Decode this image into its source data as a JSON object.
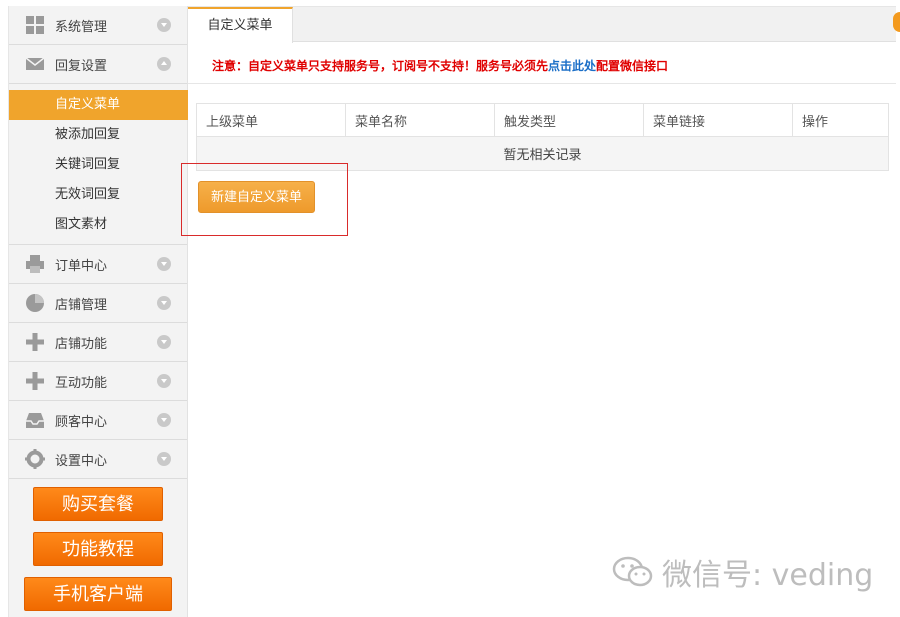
{
  "sidebar": {
    "menus": [
      {
        "label": "系统管理",
        "icon": "grid-icon",
        "expanded": false
      },
      {
        "label": "回复设置",
        "icon": "envelope-icon",
        "expanded": true
      }
    ],
    "sub_items": [
      {
        "label": "自定义菜单",
        "active": true
      },
      {
        "label": "被添加回复",
        "active": false
      },
      {
        "label": "关键词回复",
        "active": false
      },
      {
        "label": "无效词回复",
        "active": false
      },
      {
        "label": "图文素材",
        "active": false
      }
    ],
    "menus2": [
      {
        "label": "订单中心",
        "icon": "printer-icon"
      },
      {
        "label": "店铺管理",
        "icon": "pie-chart-icon"
      },
      {
        "label": "店铺功能",
        "icon": "plus-icon"
      },
      {
        "label": "互动功能",
        "icon": "plus-icon"
      },
      {
        "label": "顾客中心",
        "icon": "inbox-icon"
      },
      {
        "label": "设置中心",
        "icon": "gear-icon"
      }
    ],
    "buttons": [
      "购买套餐",
      "功能教程",
      "手机客户端"
    ]
  },
  "tab": {
    "label": "自定义菜单"
  },
  "notice": {
    "prefix": "注意：自定义菜单只支持服务号，订阅号不支持！服务号必须先",
    "link": "点击此处",
    "suffix": "配置微信接口"
  },
  "table": {
    "headers": [
      "上级菜单",
      "菜单名称",
      "触发类型",
      "菜单链接",
      "操作"
    ],
    "empty_text": "暂无相关记录"
  },
  "new_button": "新建自定义菜单",
  "watermark": "微信号: veding",
  "colors": {
    "accent": "#f0a42c",
    "notice": "#e00000",
    "link": "#1a6ec7",
    "side_button": "#f57a0c"
  }
}
